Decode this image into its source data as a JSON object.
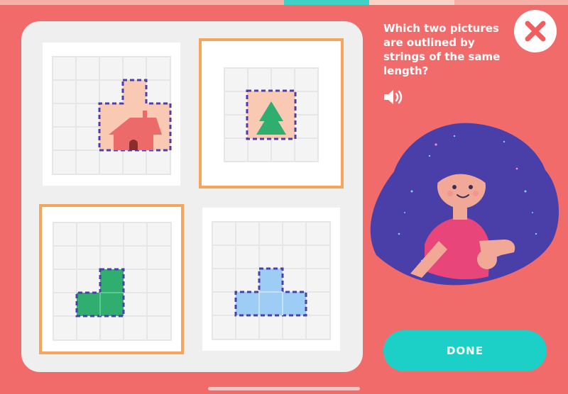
{
  "progress": {
    "segments": [
      {
        "color": "#f7b0a8",
        "label": "done-segment"
      },
      {
        "color": "#3fd1c7",
        "label": "current-segment"
      },
      {
        "color": "#f9d3c8",
        "label": "next-segment"
      }
    ]
  },
  "question": {
    "text": "Which two pictures are outlined by strings of the same length?"
  },
  "icons": {
    "close": "close-x-icon",
    "speaker": "speaker-icon"
  },
  "cards": [
    {
      "id": "house",
      "picture": "house-icon",
      "shape_color": "#f9c9b3",
      "selected": false
    },
    {
      "id": "tree",
      "picture": "tree-icon",
      "shape_color": "#f9c9b3",
      "selected": true
    },
    {
      "id": "l-shape",
      "picture": "l-shape",
      "shape_color": "#2fae6f",
      "selected": true
    },
    {
      "id": "t-shape",
      "picture": "t-shape",
      "shape_color": "#9dcdf5",
      "selected": false
    }
  ],
  "colors": {
    "background": "#f26b6b",
    "outline": "#4b3fa8",
    "selection": "#f6a65c",
    "done_button": "#1cd0c7",
    "hair": "#4a3fa8"
  },
  "done_button": {
    "label": "DONE"
  }
}
